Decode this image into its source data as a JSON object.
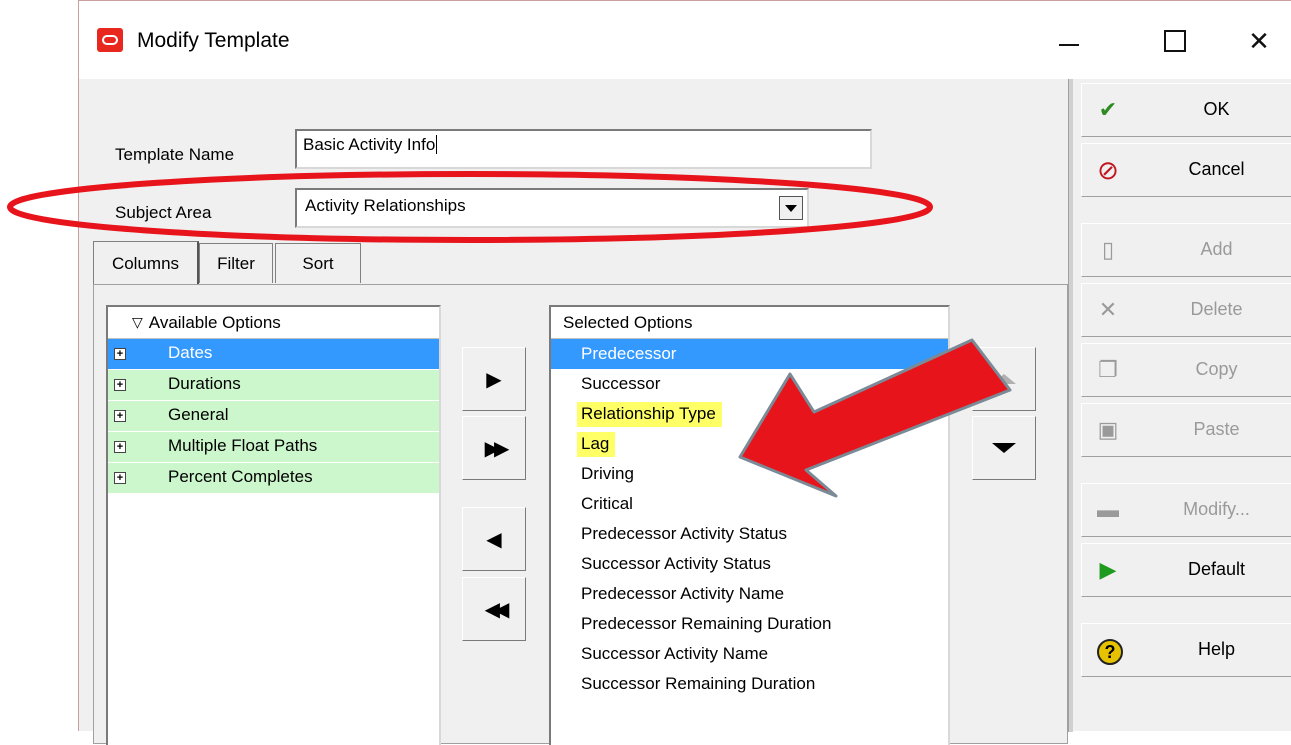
{
  "window": {
    "title": "Modify Template",
    "controls": {
      "minimize": "—",
      "close": "✕"
    }
  },
  "form": {
    "template_name_label": "Template Name",
    "template_name_value": "Basic Activity Info",
    "subject_area_label": "Subject Area",
    "subject_area_value": "Activity Relationships"
  },
  "tabs": [
    {
      "label": "Columns",
      "active": true
    },
    {
      "label": "Filter",
      "active": false
    },
    {
      "label": "Sort",
      "active": false
    }
  ],
  "available": {
    "header": "Available Options",
    "header_icon": "▽",
    "items": [
      {
        "label": "Dates",
        "selected": true
      },
      {
        "label": "Durations",
        "selected": false
      },
      {
        "label": "General",
        "selected": false
      },
      {
        "label": "Multiple Float Paths",
        "selected": false
      },
      {
        "label": "Percent Completes",
        "selected": false
      }
    ],
    "expand_glyph": "+"
  },
  "move_buttons": {
    "add_one": "▶",
    "add_all": "▶▶",
    "remove_one": "◀",
    "remove_all": "◀◀"
  },
  "selected": {
    "header": "Selected Options",
    "items": [
      {
        "label": "Predecessor",
        "selected": true,
        "highlight": false
      },
      {
        "label": "Successor",
        "selected": false,
        "highlight": false
      },
      {
        "label": "Relationship Type",
        "selected": false,
        "highlight": true
      },
      {
        "label": "Lag",
        "selected": false,
        "highlight": true
      },
      {
        "label": "Driving",
        "selected": false,
        "highlight": false
      },
      {
        "label": "Critical",
        "selected": false,
        "highlight": false
      },
      {
        "label": "Predecessor Activity Status",
        "selected": false,
        "highlight": false
      },
      {
        "label": "Successor Activity Status",
        "selected": false,
        "highlight": false
      },
      {
        "label": "Predecessor Activity Name",
        "selected": false,
        "highlight": false
      },
      {
        "label": "Predecessor Remaining Duration",
        "selected": false,
        "highlight": false
      },
      {
        "label": "Successor Activity Name",
        "selected": false,
        "highlight": false
      },
      {
        "label": "Successor Remaining Duration",
        "selected": false,
        "highlight": false
      }
    ]
  },
  "side_buttons": [
    {
      "label": "OK",
      "icon": "checkmark-icon",
      "glyph": "✔",
      "color": "#2e8b22",
      "disabled": false
    },
    {
      "label": "Cancel",
      "icon": "cancel-icon",
      "glyph": "⊘",
      "color": "#c0161e",
      "disabled": false
    },
    {
      "label": "Add",
      "icon": "new-document-icon",
      "glyph": "▯",
      "color": "#9a9a9a",
      "disabled": true
    },
    {
      "label": "Delete",
      "icon": "delete-x-icon",
      "glyph": "✕",
      "color": "#9a9a9a",
      "disabled": true
    },
    {
      "label": "Copy",
      "icon": "copy-icon",
      "glyph": "❐",
      "color": "#9a9a9a",
      "disabled": true
    },
    {
      "label": "Paste",
      "icon": "paste-icon",
      "glyph": "▣",
      "color": "#9a9a9a",
      "disabled": true
    },
    {
      "label": "Modify...",
      "icon": "monitor-icon",
      "glyph": "▬",
      "color": "#9a9a9a",
      "disabled": true
    },
    {
      "label": "Default",
      "icon": "play-icon",
      "glyph": "▶",
      "color": "#1e9a1e",
      "disabled": false
    },
    {
      "label": "Help",
      "icon": "help-icon",
      "glyph": "?",
      "color": "#e6c200",
      "disabled": false
    }
  ],
  "colors": {
    "annotation_red": "#e8141c",
    "selection_blue": "#3399ff",
    "available_green": "#ccf7cc",
    "highlight_yellow": "#ffff66"
  }
}
